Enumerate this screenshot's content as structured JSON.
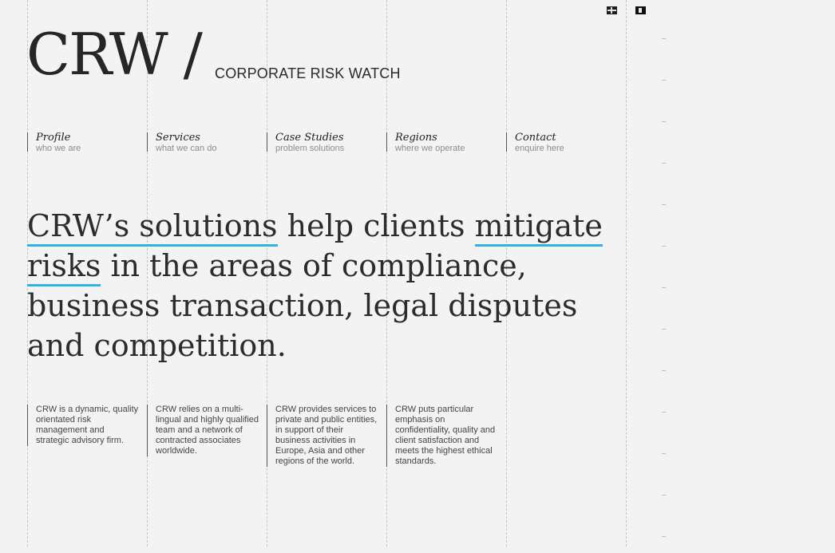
{
  "header": {
    "logo": "CRW /",
    "tagline": "CORPORATE RISK WATCH"
  },
  "languages": [
    {
      "name": "english-flag-icon"
    },
    {
      "name": "second-language-flag-icon"
    }
  ],
  "nav": [
    {
      "title": "Profile",
      "subtitle": "who we are"
    },
    {
      "title": "Services",
      "subtitle": "what we can do"
    },
    {
      "title": "Case Studies",
      "subtitle": "problem solutions"
    },
    {
      "title": "Regions",
      "subtitle": "where we operate"
    },
    {
      "title": "Contact",
      "subtitle": "enquire here"
    }
  ],
  "headline": {
    "part1": "CRW’s solutions",
    "part2": " help clients ",
    "part3": "mitigate risks",
    "part4": " in the areas of compliance, business transaction, legal disputes and competition.",
    "highlight_color": "#2fb3e0"
  },
  "columns": [
    {
      "text": "CRW is a dynamic, quality orientated risk management and strategic advisory firm."
    },
    {
      "text": "CRW relies on a multi-lingual and highly qualified team and a network of contracted associates worldwide."
    },
    {
      "text": "CRW provides services to private and public entities, in support of their business activities in Europe, Asia and other regions of the world."
    },
    {
      "text": "CRW puts particular emphasis on confidentiality, quality and client satisfaction and meets the highest ethical standards."
    }
  ]
}
